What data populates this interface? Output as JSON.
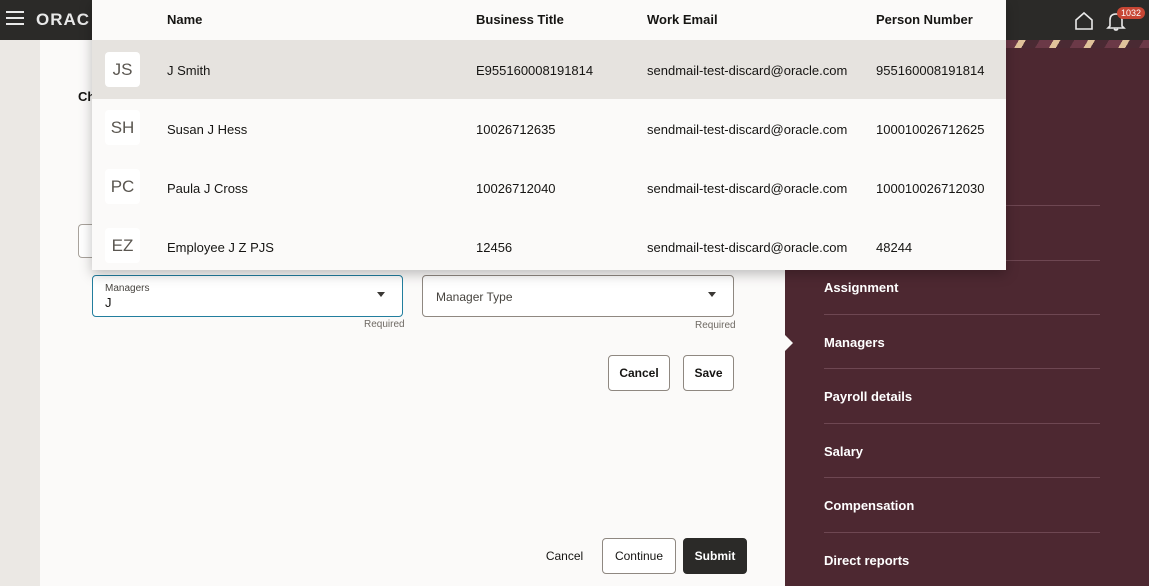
{
  "topbar": {
    "brand": "ORAC",
    "notification_count": "1032"
  },
  "form": {
    "partial_title": "Ch",
    "managers_label": "Managers",
    "managers_value": "J",
    "managers_required": "Required",
    "manager_type_placeholder": "Manager Type",
    "manager_type_required": "Required",
    "cancel_label": "Cancel",
    "save_label": "Save"
  },
  "footer": {
    "cancel_label": "Cancel",
    "continue_label": "Continue",
    "submit_label": "Submit"
  },
  "sidenav": {
    "items": [
      {
        "label": "Assignment"
      },
      {
        "label": "Managers"
      },
      {
        "label": "Payroll details"
      },
      {
        "label": "Salary"
      },
      {
        "label": "Compensation"
      },
      {
        "label": "Direct reports"
      }
    ]
  },
  "dropdown": {
    "columns": [
      "Name",
      "Business Title",
      "Work Email",
      "Person Number"
    ],
    "rows": [
      {
        "initials": "JS",
        "name": "J Smith",
        "title": "E955160008191814",
        "email": "sendmail-test-discard@oracle.com",
        "number": "955160008191814"
      },
      {
        "initials": "SH",
        "name": "Susan J Hess",
        "title": "10026712635",
        "email": "sendmail-test-discard@oracle.com",
        "number": "100010026712625"
      },
      {
        "initials": "PC",
        "name": "Paula J Cross",
        "title": "10026712040",
        "email": "sendmail-test-discard@oracle.com",
        "number": "100010026712030"
      },
      {
        "initials": "EZ",
        "name": "Employee J Z PJS",
        "title": "12456",
        "email": "sendmail-test-discard@oracle.com",
        "number": "48244"
      }
    ]
  }
}
